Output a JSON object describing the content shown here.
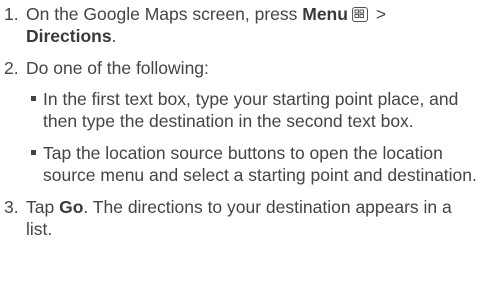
{
  "steps": [
    {
      "num": "1.",
      "pre": "On the Google Maps screen, press ",
      "bold1": "Menu",
      "icon": "menu-key-icon",
      "sep": " >",
      "bold2": "Directions",
      "post": "."
    },
    {
      "num": "2.",
      "text": "Do one of the following:",
      "bullets": [
        "In the first text box, type your starting point place, and then type the destination in the second text box.",
        "Tap the location source buttons to open the location source menu and select a starting point and destination."
      ]
    },
    {
      "num": "3.",
      "pre": "Tap ",
      "bold": "Go",
      "post": ". The directions to your destination appears in a list."
    }
  ]
}
